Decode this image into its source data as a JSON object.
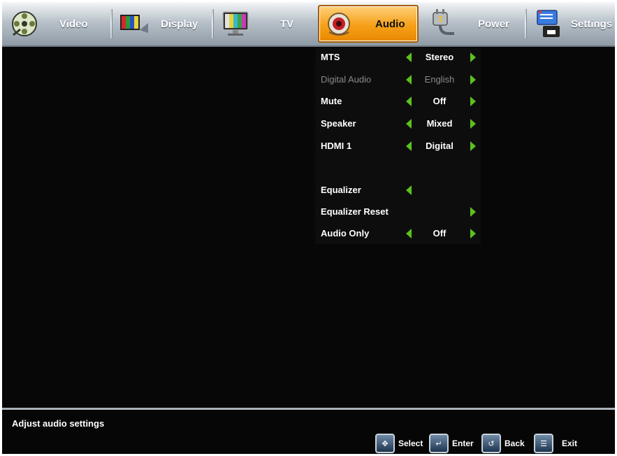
{
  "tabs": [
    {
      "label": "Video",
      "icon": "film-reel-icon"
    },
    {
      "label": "Display",
      "icon": "color-bars-icon"
    },
    {
      "label": "TV",
      "icon": "tv-monitor-icon"
    },
    {
      "label": "Audio",
      "icon": "speaker-icon",
      "active": true
    },
    {
      "label": "Power",
      "icon": "power-plug-icon"
    },
    {
      "label": "Settings",
      "icon": "settings-icon"
    }
  ],
  "menu": [
    {
      "name": "MTS",
      "value": "Stereo",
      "left": true,
      "right": true
    },
    {
      "name": "Digital Audio",
      "value": "English",
      "left": true,
      "right": true,
      "disabled": true
    },
    {
      "name": "Mute",
      "value": "Off",
      "left": true,
      "right": true
    },
    {
      "name": "Speaker",
      "value": "Mixed",
      "left": true,
      "right": true
    },
    {
      "name": "HDMI 1",
      "value": "Digital",
      "left": true,
      "right": true
    },
    {
      "name": "Equalizer",
      "value": "",
      "left": true,
      "right": false
    },
    {
      "name": "Equalizer Reset",
      "value": "",
      "left": false,
      "right": true
    },
    {
      "name": "Audio Only",
      "value": "Off",
      "left": true,
      "right": true
    }
  ],
  "footer": {
    "status": "Adjust audio settings",
    "hints": [
      {
        "label": "Select",
        "icon": "dpad-icon"
      },
      {
        "label": "Enter",
        "icon": "enter-key-icon"
      },
      {
        "label": "Back",
        "icon": "back-icon"
      },
      {
        "label": "Exit",
        "icon": "exit-icon"
      }
    ]
  },
  "colors": {
    "accent": "#f6a019",
    "arrow": "#5bc21e",
    "background": "#070707"
  }
}
